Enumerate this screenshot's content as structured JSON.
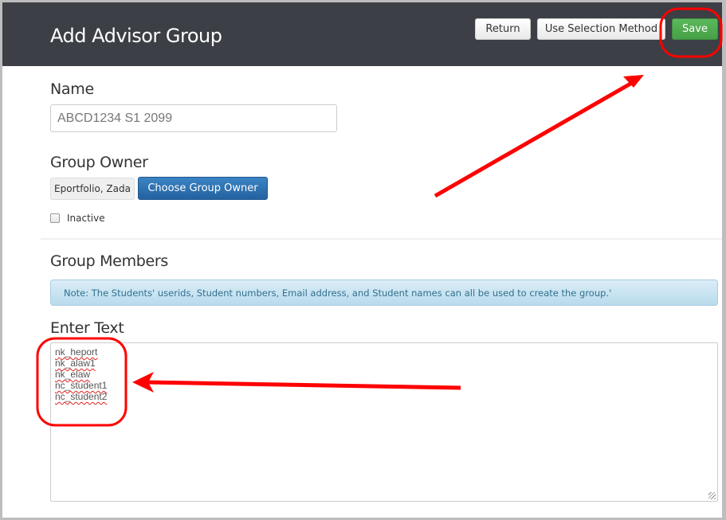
{
  "header": {
    "title": "Add Advisor Group",
    "buttons": {
      "return": "Return",
      "use_selection_method": "Use Selection Method",
      "save": "Save"
    }
  },
  "form": {
    "name_label": "Name",
    "name_value": "ABCD1234 S1 2099",
    "group_owner_label": "Group Owner",
    "group_owner_value": "Eportfolio, Zada",
    "choose_owner_button": "Choose Group Owner",
    "inactive_label": "Inactive",
    "inactive_checked": false,
    "group_members_label": "Group Members",
    "note": "Note: The Students' userids, Student numbers, Email address, and Student names can all be used to create the group.'",
    "enter_text_label": "Enter Text",
    "entered_lines": [
      "nk_heport",
      "nk_alaw1",
      "nk_elaw",
      "nc_student1",
      "nc_student2"
    ]
  },
  "annotations": {
    "color": "#ff0000",
    "items": [
      "circle-save-button",
      "arrow-to-save-button",
      "circle-entered-text",
      "arrow-to-entered-text"
    ]
  }
}
